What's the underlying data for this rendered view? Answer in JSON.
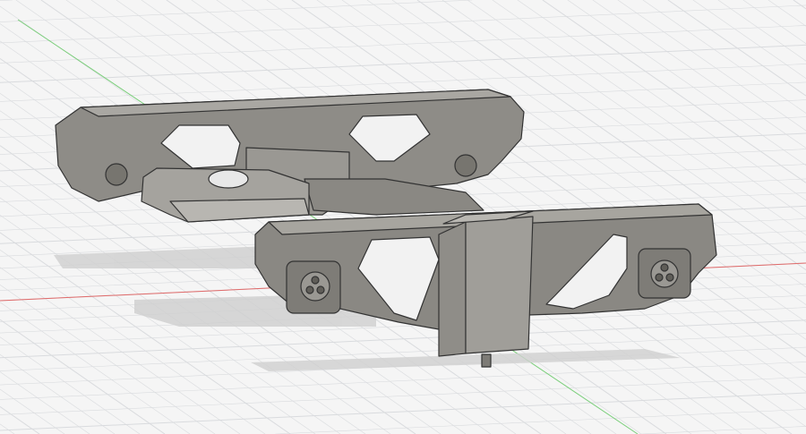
{
  "viewport": {
    "background": "#f5f5f5",
    "grid_color": "#d9dbde",
    "x_axis_color": "#e06a6a",
    "y_axis_color": "#7ccf7c",
    "model_color": "#8c8a85",
    "model_edge_color": "#3a3a3a",
    "shadow_color": "#d0d0d0"
  }
}
